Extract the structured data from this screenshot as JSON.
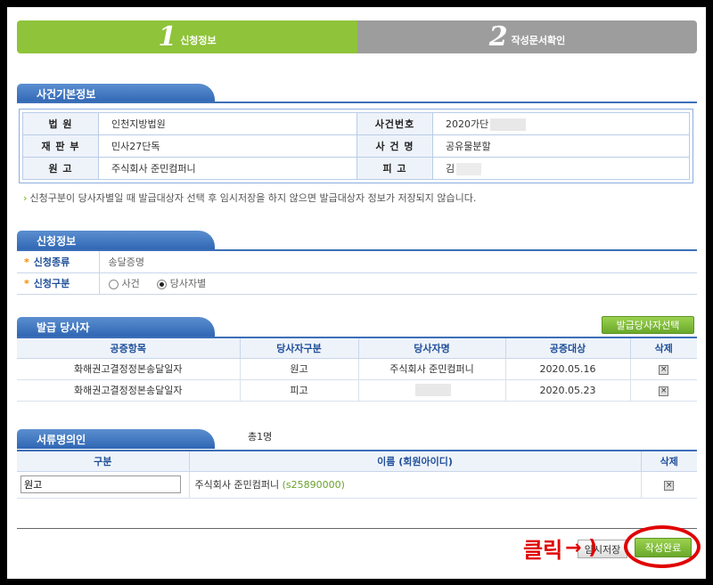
{
  "steps": [
    {
      "num": "1",
      "label": "신청정보"
    },
    {
      "num": "2",
      "label": "작성문서확인"
    }
  ],
  "case_info": {
    "title": "사건기본정보",
    "court_label": "법 원",
    "court_value": "인천지방법원",
    "case_no_label": "사건번호",
    "case_no_value": "2020가단",
    "division_label": "재 판 부",
    "division_value": "민사27단독",
    "case_name_label": "사 건 명",
    "case_name_value": "공유물분할",
    "plaintiff_label": "원 고",
    "plaintiff_value": "주식회사 준민컴퍼니",
    "defendant_label": "피 고",
    "defendant_value": "김"
  },
  "notice": "신청구분이 당사자별일 때 발급대상자 선택 후 임시저장을 하지 않으면 발급대상자 정보가 저장되지 않습니다.",
  "application": {
    "title": "신청정보",
    "type_label": "신청종류",
    "type_value": "송달증명",
    "division_label": "신청구분",
    "option_case": "사건",
    "option_party": "당사자별",
    "selected": "당사자별"
  },
  "issue_party": {
    "title": "발급 당사자",
    "select_button": "발급당사자선택",
    "headers": [
      "공증항목",
      "당사자구분",
      "당사자명",
      "공증대상",
      "삭제"
    ],
    "rows": [
      {
        "item": "화해권고결정정본송달일자",
        "kind": "원고",
        "name": "주식회사 준민컴퍼니",
        "date": "2020.05.16"
      },
      {
        "item": "화해권고결정정본송달일자",
        "kind": "피고",
        "name": "",
        "date": "2020.05.23"
      }
    ]
  },
  "signer": {
    "title": "서류명의인",
    "total": "총1명",
    "headers": [
      "구분",
      "이름 (회원아이디)",
      "삭제"
    ],
    "row": {
      "kind": "원고",
      "name": "주식회사 준민컴퍼니",
      "uid": "(s25890000)"
    }
  },
  "buttons": {
    "temp_save": "임시저장",
    "complete": "작성완료"
  },
  "annotation": {
    "click": "클릭",
    "arrow": "→ )"
  }
}
